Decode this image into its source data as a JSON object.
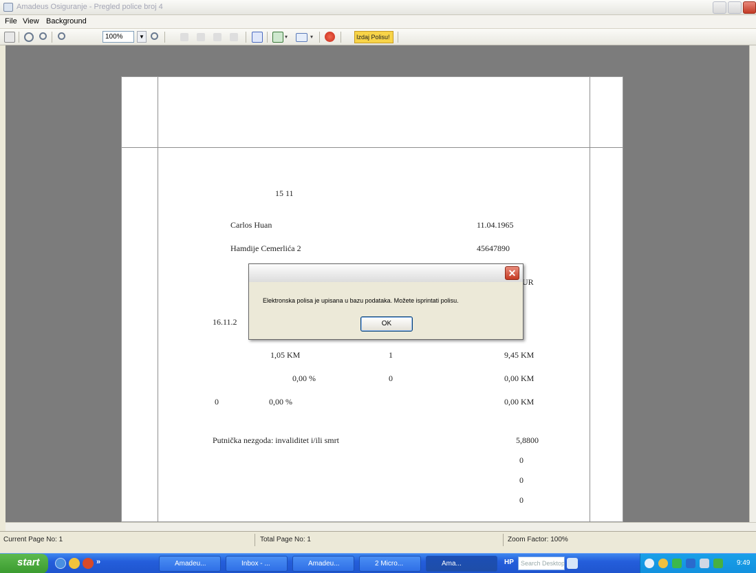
{
  "window": {
    "title": "Amadeus Osiguranje - Pregled police broj 4"
  },
  "menu": [
    "File",
    "View",
    "Background"
  ],
  "toolbar": {
    "zoom_value": "100%",
    "print_button_label": "Izdaj Polisu!"
  },
  "document": {
    "line_number": "15   11",
    "name": "Carlos Huan",
    "birth_date": "11.04.1965",
    "address": "Hamdije Cemerlića 2",
    "phone": "45647890",
    "currency_fragment": "UR",
    "date_fragment": "16.11.2",
    "row1": {
      "price": "1,05 KM",
      "qty": "1",
      "total": "9,45 KM"
    },
    "row2": {
      "percent": "0,00 %",
      "qty": "0",
      "total": "0,00 KM"
    },
    "row3": {
      "num": "0",
      "percent": "0,00 %",
      "total": "0,00 KM"
    },
    "accident_label": "Putnička nezgoda: invaliditet i/ili smrt",
    "accident_value": "5,8800",
    "zeros": [
      "0",
      "0",
      "0"
    ]
  },
  "dialog": {
    "message": "Elektronska polisa je upisana u bazu podataka. Možete isprintati polisu.",
    "ok_label": "OK"
  },
  "status": {
    "current_page": "Current Page No: 1",
    "total_page": "Total Page No: 1",
    "zoom_factor": "Zoom Factor: 100%"
  },
  "taskbar": {
    "start_label": "start",
    "tasks": [
      "Amadeu...",
      "Inbox - ...",
      "Amadeu...",
      "2 Micro...",
      "Ama..."
    ],
    "search_placeholder": "Search Desktop",
    "clock": "9:49"
  }
}
